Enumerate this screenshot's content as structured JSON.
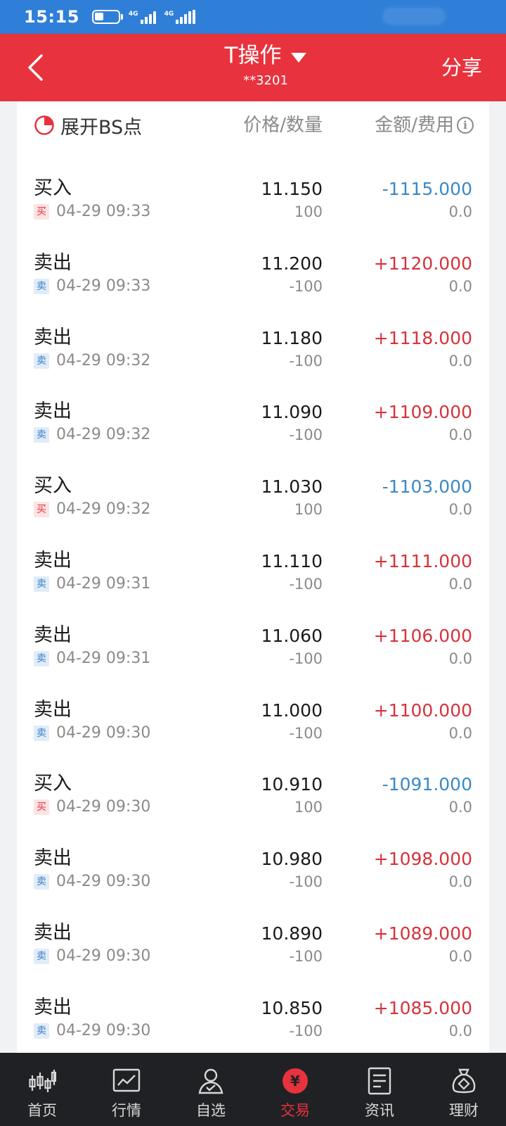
{
  "status": {
    "time": "15:15",
    "signal1_label": "4G",
    "signal2_label": "4G"
  },
  "header": {
    "title": "T操作",
    "account": "**3201",
    "share_label": "分享",
    "back_icon": "chevron-left-icon",
    "dropdown_icon": "caret-down-icon"
  },
  "list_header": {
    "bs_toggle_label": "展开BS点",
    "price_qty_label": "价格/数量",
    "amount_fee_label": "金额/费用",
    "info_icon": "i"
  },
  "colors": {
    "brand_red": "#e8323d",
    "amount_negative": "#3b89c4",
    "amount_positive": "#d6333b"
  },
  "trades": [
    {
      "type": "买入",
      "tag": "买",
      "side": "buy",
      "time": "04-29 09:33",
      "price": "11.150",
      "qty": "100",
      "amount": "-1115.000",
      "fee": "0.0"
    },
    {
      "type": "卖出",
      "tag": "卖",
      "side": "sell",
      "time": "04-29 09:33",
      "price": "11.200",
      "qty": "-100",
      "amount": "+1120.000",
      "fee": "0.0"
    },
    {
      "type": "卖出",
      "tag": "卖",
      "side": "sell",
      "time": "04-29 09:32",
      "price": "11.180",
      "qty": "-100",
      "amount": "+1118.000",
      "fee": "0.0"
    },
    {
      "type": "卖出",
      "tag": "卖",
      "side": "sell",
      "time": "04-29 09:32",
      "price": "11.090",
      "qty": "-100",
      "amount": "+1109.000",
      "fee": "0.0"
    },
    {
      "type": "买入",
      "tag": "买",
      "side": "buy",
      "time": "04-29 09:32",
      "price": "11.030",
      "qty": "100",
      "amount": "-1103.000",
      "fee": "0.0"
    },
    {
      "type": "卖出",
      "tag": "卖",
      "side": "sell",
      "time": "04-29 09:31",
      "price": "11.110",
      "qty": "-100",
      "amount": "+1111.000",
      "fee": "0.0"
    },
    {
      "type": "卖出",
      "tag": "卖",
      "side": "sell",
      "time": "04-29 09:31",
      "price": "11.060",
      "qty": "-100",
      "amount": "+1106.000",
      "fee": "0.0"
    },
    {
      "type": "卖出",
      "tag": "卖",
      "side": "sell",
      "time": "04-29 09:30",
      "price": "11.000",
      "qty": "-100",
      "amount": "+1100.000",
      "fee": "0.0"
    },
    {
      "type": "买入",
      "tag": "买",
      "side": "buy",
      "time": "04-29 09:30",
      "price": "10.910",
      "qty": "100",
      "amount": "-1091.000",
      "fee": "0.0"
    },
    {
      "type": "卖出",
      "tag": "卖",
      "side": "sell",
      "time": "04-29 09:30",
      "price": "10.980",
      "qty": "-100",
      "amount": "+1098.000",
      "fee": "0.0"
    },
    {
      "type": "卖出",
      "tag": "卖",
      "side": "sell",
      "time": "04-29 09:30",
      "price": "10.890",
      "qty": "-100",
      "amount": "+1089.000",
      "fee": "0.0"
    },
    {
      "type": "卖出",
      "tag": "卖",
      "side": "sell",
      "time": "04-29 09:30",
      "price": "10.850",
      "qty": "-100",
      "amount": "+1085.000",
      "fee": "0.0"
    }
  ],
  "bottom_nav": [
    {
      "label": "首页",
      "icon": "candlestick-icon",
      "active": false
    },
    {
      "label": "行情",
      "icon": "chart-line-icon",
      "active": false
    },
    {
      "label": "自选",
      "icon": "user-check-icon",
      "active": false
    },
    {
      "label": "交易",
      "icon": "yuan-circle-icon",
      "active": true
    },
    {
      "label": "资讯",
      "icon": "document-icon",
      "active": false
    },
    {
      "label": "理财",
      "icon": "money-bag-icon",
      "active": false
    }
  ]
}
